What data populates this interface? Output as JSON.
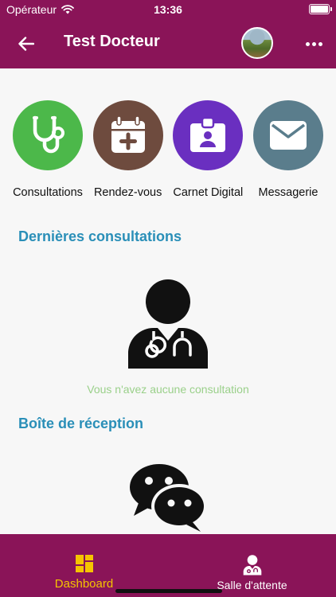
{
  "status_bar": {
    "carrier": "Opérateur",
    "time": "13:36"
  },
  "header": {
    "title": "Test Docteur"
  },
  "actions": [
    {
      "label": "Consultations",
      "color": "#4cb84a",
      "icon": "stethoscope-icon"
    },
    {
      "label": "Rendez-vous",
      "color": "#6e4b3e",
      "icon": "calendar-plus-icon"
    },
    {
      "label": "Carnet Digital",
      "color": "#6a2fc0",
      "icon": "id-badge-icon"
    },
    {
      "label": "Messagerie",
      "color": "#5a7d8c",
      "icon": "envelope-icon"
    }
  ],
  "consultations": {
    "title": "Dernières consultations",
    "empty_text": "Vous n'avez aucune consultation"
  },
  "inbox": {
    "title": "Boîte de réception"
  },
  "tabbar": {
    "tabs": [
      {
        "label": "Dashboard",
        "active": true,
        "color": "#f5c400",
        "icon": "dashboard-icon"
      },
      {
        "label": "Salle d'attente",
        "active": false,
        "color": "#ffffff",
        "icon": "doctor-icon"
      }
    ]
  },
  "theme": {
    "primary": "#8a1458",
    "section_title": "#2a8fb8",
    "empty_text": "#9ad08a"
  }
}
